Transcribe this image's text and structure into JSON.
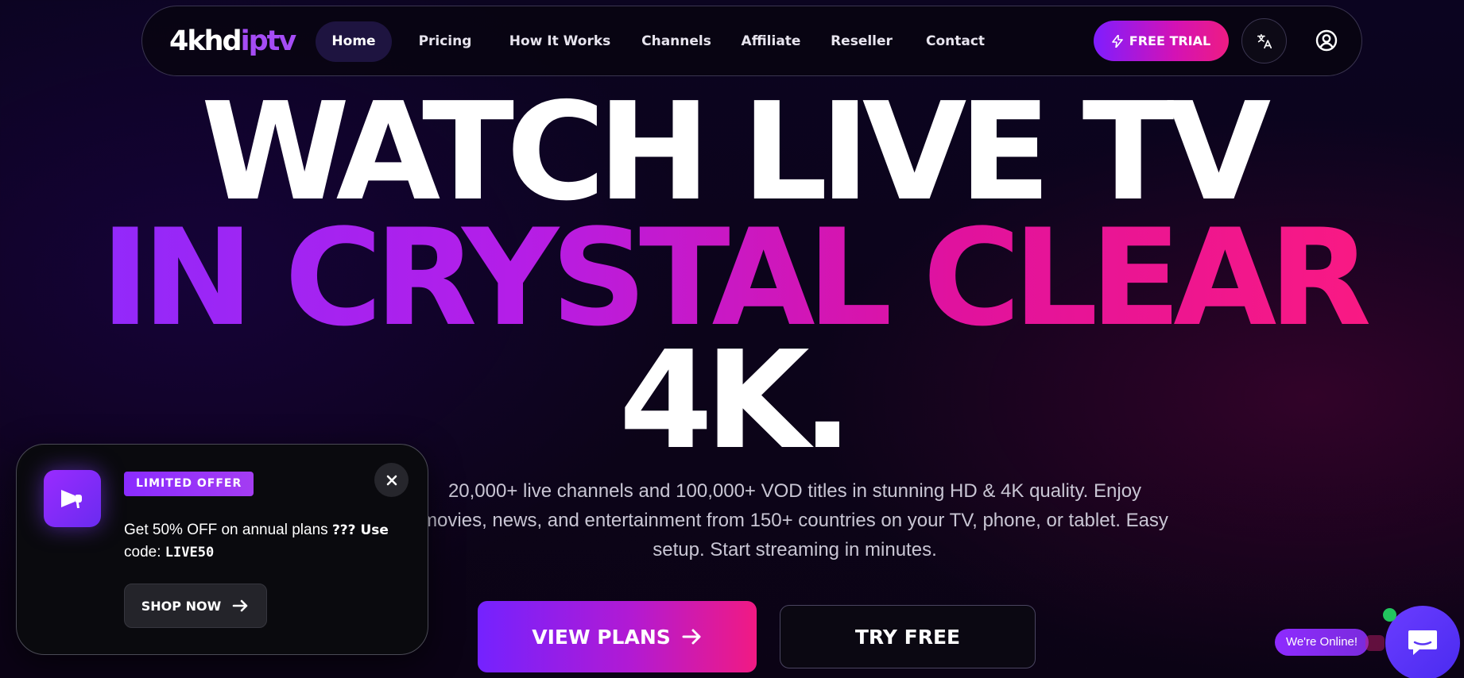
{
  "nav": {
    "logo_main": "4khd",
    "logo_accent": "iptv",
    "items": [
      {
        "label": "Home",
        "active": true
      },
      {
        "label": "Pricing",
        "active": false
      },
      {
        "label": "How It Works",
        "active": false
      },
      {
        "label": "Channels",
        "active": false
      },
      {
        "label": "Affiliate",
        "active": false
      },
      {
        "label": "Reseller",
        "active": false
      },
      {
        "label": "Contact",
        "active": false
      }
    ],
    "free_trial_label": "FREE TRIAL",
    "language_icon": "translate-icon",
    "account_icon": "user-circle-icon"
  },
  "hero": {
    "line1": "WATCH LIVE TV",
    "line2": "IN CRYSTAL CLEAR",
    "line3": "4K.",
    "subtitle": "20,000+ live channels and 100,000+ VOD titles in stunning HD & 4K quality. Enjoy movies, news, and entertainment from 150+ countries on your TV, phone, or tablet. Easy setup. Start streaming in minutes.",
    "view_plans_label": "VIEW PLANS",
    "try_free_label": "TRY FREE"
  },
  "promo": {
    "badge": "LIMITED OFFER",
    "text_before": "Get 50% OFF on annual plans ",
    "text_bold": "??? Use",
    "text_code_prefix": "code: ",
    "code": "LIVE50",
    "shop_label": "SHOP NOW",
    "icon": "megaphone-icon"
  },
  "chat": {
    "status_label": "We're Online!",
    "icon": "chat-bubble-icon"
  },
  "colors": {
    "accent_purple": "#8a2cff",
    "accent_pink": "#ff1b7d",
    "online_green": "#22c55e"
  }
}
